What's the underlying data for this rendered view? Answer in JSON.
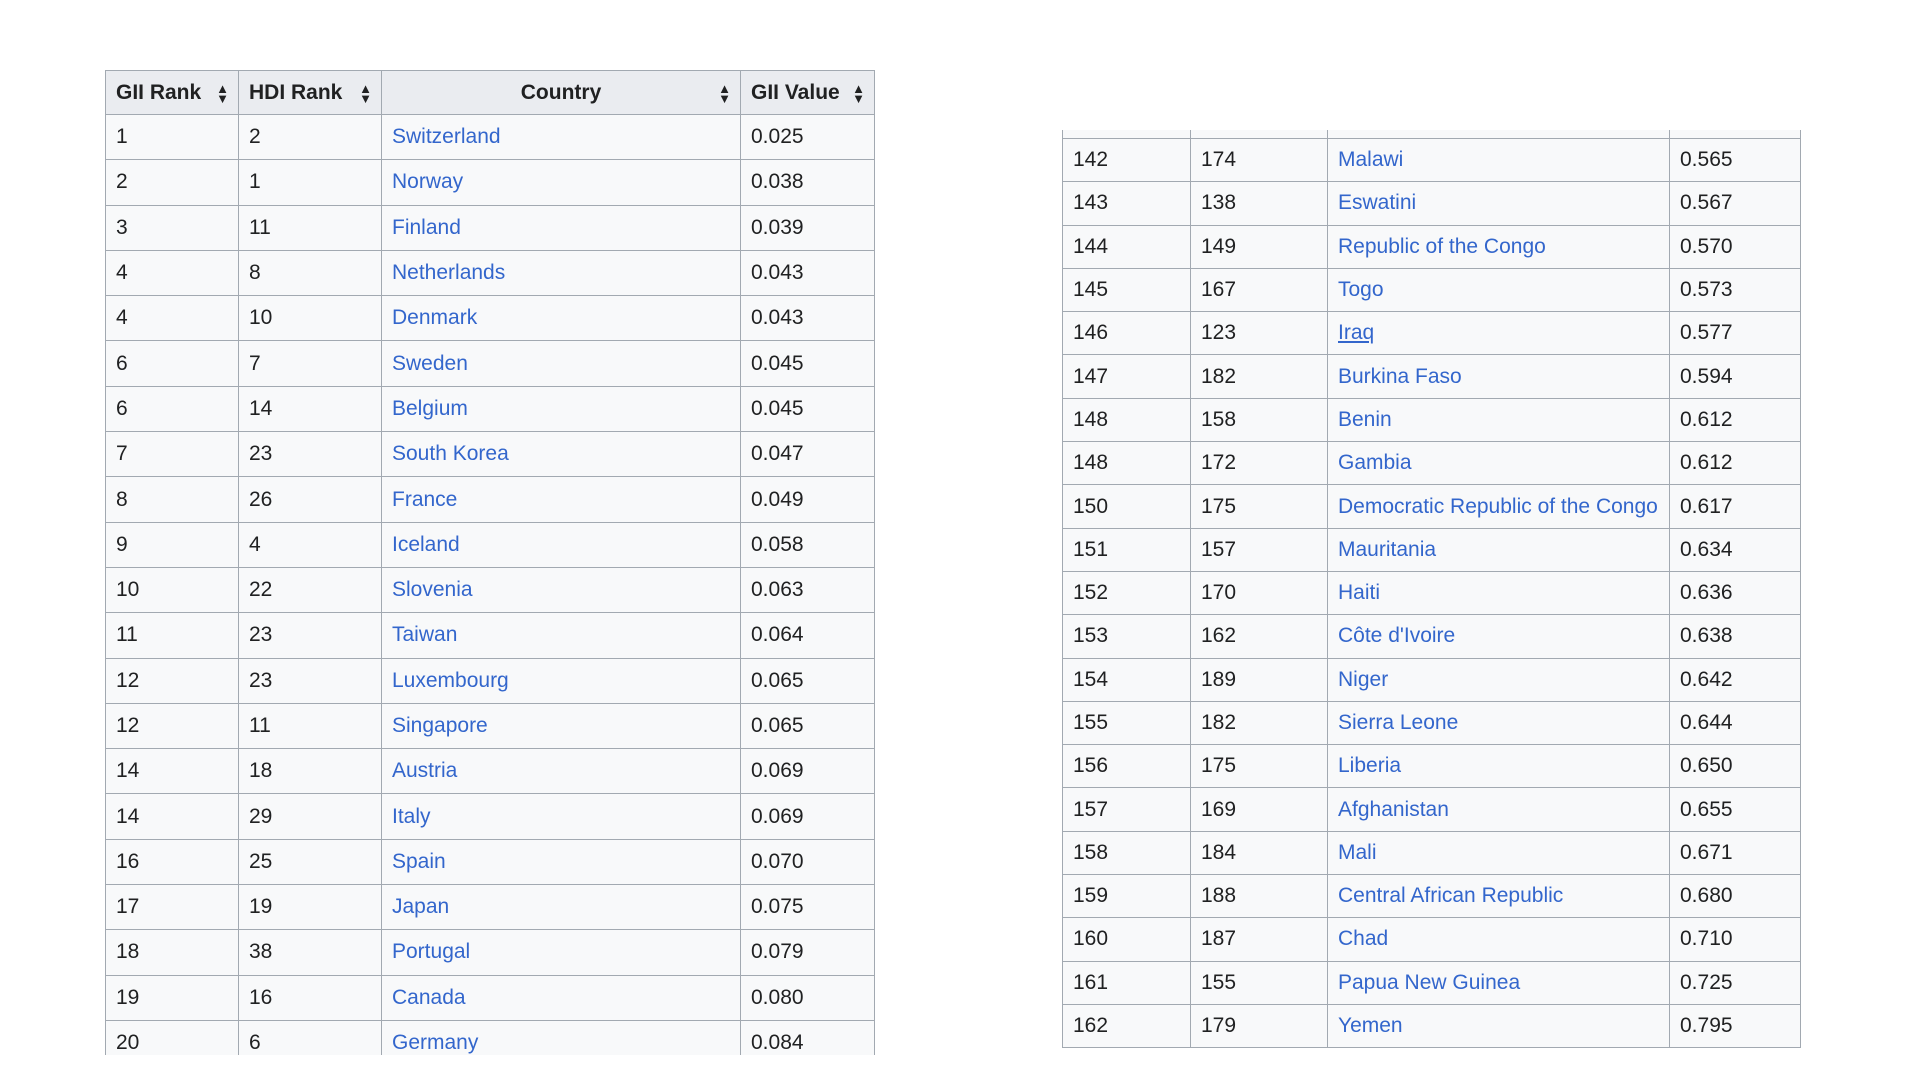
{
  "left_table": {
    "columns": [
      "GII Rank",
      "HDI Rank",
      "Country",
      "GII Value"
    ],
    "rows": [
      {
        "gii_rank": "1",
        "hdi_rank": "2",
        "country": "Switzerland",
        "gii_value": "0.025"
      },
      {
        "gii_rank": "2",
        "hdi_rank": "1",
        "country": "Norway",
        "gii_value": "0.038"
      },
      {
        "gii_rank": "3",
        "hdi_rank": "11",
        "country": "Finland",
        "gii_value": "0.039"
      },
      {
        "gii_rank": "4",
        "hdi_rank": "8",
        "country": "Netherlands",
        "gii_value": "0.043"
      },
      {
        "gii_rank": "4",
        "hdi_rank": "10",
        "country": "Denmark",
        "gii_value": "0.043"
      },
      {
        "gii_rank": "6",
        "hdi_rank": "7",
        "country": "Sweden",
        "gii_value": "0.045"
      },
      {
        "gii_rank": "6",
        "hdi_rank": "14",
        "country": "Belgium",
        "gii_value": "0.045"
      },
      {
        "gii_rank": "7",
        "hdi_rank": "23",
        "country": "South Korea",
        "gii_value": "0.047"
      },
      {
        "gii_rank": "8",
        "hdi_rank": "26",
        "country": "France",
        "gii_value": "0.049"
      },
      {
        "gii_rank": "9",
        "hdi_rank": "4",
        "country": "Iceland",
        "gii_value": "0.058"
      },
      {
        "gii_rank": "10",
        "hdi_rank": "22",
        "country": "Slovenia",
        "gii_value": "0.063"
      },
      {
        "gii_rank": "11",
        "hdi_rank": "23",
        "country": "Taiwan",
        "gii_value": "0.064"
      },
      {
        "gii_rank": "12",
        "hdi_rank": "23",
        "country": "Luxembourg",
        "gii_value": "0.065"
      },
      {
        "gii_rank": "12",
        "hdi_rank": "11",
        "country": "Singapore",
        "gii_value": "0.065"
      },
      {
        "gii_rank": "14",
        "hdi_rank": "18",
        "country": "Austria",
        "gii_value": "0.069"
      },
      {
        "gii_rank": "14",
        "hdi_rank": "29",
        "country": "Italy",
        "gii_value": "0.069"
      },
      {
        "gii_rank": "16",
        "hdi_rank": "25",
        "country": "Spain",
        "gii_value": "0.070"
      },
      {
        "gii_rank": "17",
        "hdi_rank": "19",
        "country": "Japan",
        "gii_value": "0.075"
      },
      {
        "gii_rank": "18",
        "hdi_rank": "38",
        "country": "Portugal",
        "gii_value": "0.079"
      },
      {
        "gii_rank": "19",
        "hdi_rank": "16",
        "country": "Canada",
        "gii_value": "0.080"
      },
      {
        "gii_rank": "20",
        "hdi_rank": "6",
        "country": "Germany",
        "gii_value": "0.084"
      }
    ]
  },
  "right_table": {
    "rows": [
      {
        "gii_rank": "142",
        "hdi_rank": "174",
        "country": "Malawi",
        "gii_value": "0.565"
      },
      {
        "gii_rank": "143",
        "hdi_rank": "138",
        "country": "Eswatini",
        "gii_value": "0.567"
      },
      {
        "gii_rank": "144",
        "hdi_rank": "149",
        "country": "Republic of the Congo",
        "gii_value": "0.570"
      },
      {
        "gii_rank": "145",
        "hdi_rank": "167",
        "country": "Togo",
        "gii_value": "0.573"
      },
      {
        "gii_rank": "146",
        "hdi_rank": "123",
        "country": "Iraq",
        "gii_value": "0.577",
        "underlined": true
      },
      {
        "gii_rank": "147",
        "hdi_rank": "182",
        "country": "Burkina Faso",
        "gii_value": "0.594"
      },
      {
        "gii_rank": "148",
        "hdi_rank": "158",
        "country": "Benin",
        "gii_value": "0.612"
      },
      {
        "gii_rank": "148",
        "hdi_rank": "172",
        "country": "Gambia",
        "gii_value": "0.612"
      },
      {
        "gii_rank": "150",
        "hdi_rank": "175",
        "country": "Democratic Republic of the Congo",
        "gii_value": "0.617"
      },
      {
        "gii_rank": "151",
        "hdi_rank": "157",
        "country": "Mauritania",
        "gii_value": "0.634"
      },
      {
        "gii_rank": "152",
        "hdi_rank": "170",
        "country": "Haiti",
        "gii_value": "0.636"
      },
      {
        "gii_rank": "153",
        "hdi_rank": "162",
        "country": "Côte d'Ivoire",
        "gii_value": "0.638"
      },
      {
        "gii_rank": "154",
        "hdi_rank": "189",
        "country": "Niger",
        "gii_value": "0.642"
      },
      {
        "gii_rank": "155",
        "hdi_rank": "182",
        "country": "Sierra Leone",
        "gii_value": "0.644"
      },
      {
        "gii_rank": "156",
        "hdi_rank": "175",
        "country": "Liberia",
        "gii_value": "0.650"
      },
      {
        "gii_rank": "157",
        "hdi_rank": "169",
        "country": "Afghanistan",
        "gii_value": "0.655"
      },
      {
        "gii_rank": "158",
        "hdi_rank": "184",
        "country": "Mali",
        "gii_value": "0.671"
      },
      {
        "gii_rank": "159",
        "hdi_rank": "188",
        "country": "Central African Republic",
        "gii_value": "0.680"
      },
      {
        "gii_rank": "160",
        "hdi_rank": "187",
        "country": "Chad",
        "gii_value": "0.710"
      },
      {
        "gii_rank": "161",
        "hdi_rank": "155",
        "country": "Papua New Guinea",
        "gii_value": "0.725"
      },
      {
        "gii_rank": "162",
        "hdi_rank": "179",
        "country": "Yemen",
        "gii_value": "0.795"
      }
    ]
  },
  "icons": {
    "sort": "sort-up-down-icon"
  },
  "colors": {
    "link": "#3366cc",
    "header_bg": "#eaecf0",
    "cell_bg": "#f8f9fa",
    "border": "#a2a9b1"
  }
}
